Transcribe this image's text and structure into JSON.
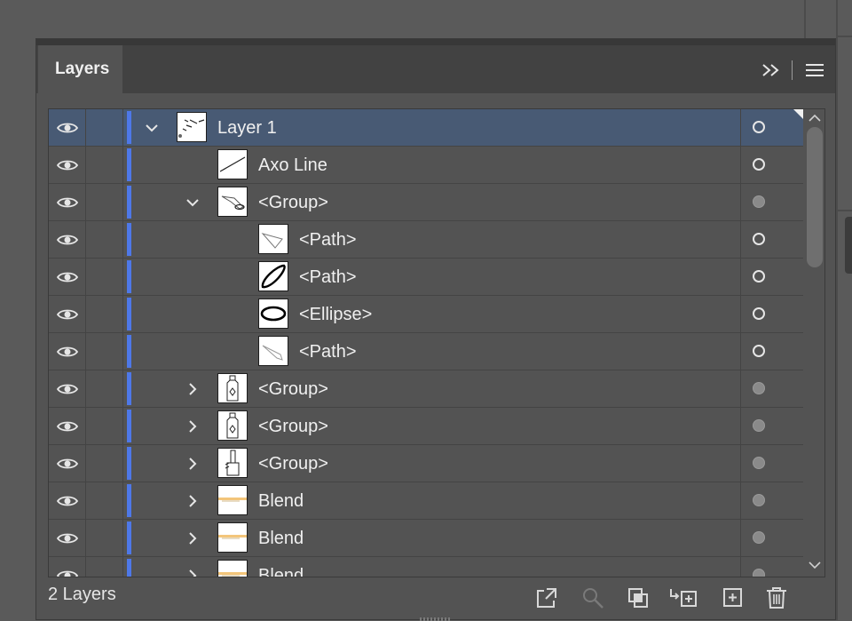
{
  "panel": {
    "tab_label": "Layers",
    "collapse_icon": "double-chevron-right-icon",
    "menu_icon": "hamburger-menu-icon"
  },
  "rows": [
    {
      "name": "Layer 1",
      "indent": 0,
      "toggle": "chevron-down",
      "thumb": "layer",
      "target": "hollow",
      "selected": true
    },
    {
      "name": "Axo Line",
      "indent": 1,
      "toggle": "none",
      "thumb": "line",
      "target": "hollow",
      "selected": false
    },
    {
      "name": "<Group>",
      "indent": 1,
      "toggle": "chevron-down",
      "thumb": "group-shape",
      "target": "filled",
      "selected": false
    },
    {
      "name": "<Path>",
      "indent": 2,
      "toggle": "none",
      "thumb": "path-light",
      "target": "hollow",
      "selected": false
    },
    {
      "name": "<Path>",
      "indent": 2,
      "toggle": "none",
      "thumb": "path-bold",
      "target": "hollow",
      "selected": false
    },
    {
      "name": "<Ellipse>",
      "indent": 2,
      "toggle": "none",
      "thumb": "ellipse",
      "target": "hollow",
      "selected": false
    },
    {
      "name": "<Path>",
      "indent": 2,
      "toggle": "none",
      "thumb": "path-faint",
      "target": "hollow",
      "selected": false
    },
    {
      "name": "<Group>",
      "indent": 1,
      "toggle": "chevron-right",
      "thumb": "bottle",
      "target": "filled",
      "selected": false
    },
    {
      "name": "<Group>",
      "indent": 1,
      "toggle": "chevron-right",
      "thumb": "bottle",
      "target": "filled",
      "selected": false
    },
    {
      "name": "<Group>",
      "indent": 1,
      "toggle": "chevron-right",
      "thumb": "brush",
      "target": "filled",
      "selected": false
    },
    {
      "name": "Blend",
      "indent": 1,
      "toggle": "chevron-right",
      "thumb": "blend",
      "target": "filled",
      "selected": false
    },
    {
      "name": "Blend",
      "indent": 1,
      "toggle": "chevron-right",
      "thumb": "blend",
      "target": "filled",
      "selected": false
    },
    {
      "name": "Blend",
      "indent": 1,
      "toggle": "chevron-right",
      "thumb": "blend",
      "target": "filled",
      "selected": false
    }
  ],
  "footer": {
    "layer_count": "2 Layers",
    "buttons": [
      {
        "name": "export-button",
        "icon": "export-icon"
      },
      {
        "name": "locate-object-button",
        "icon": "magnifier-icon"
      },
      {
        "name": "clipping-mask-button",
        "icon": "clipping-mask-icon"
      },
      {
        "name": "create-sublayer-button",
        "icon": "new-sublayer-icon"
      },
      {
        "name": "create-layer-button",
        "icon": "new-layer-icon"
      },
      {
        "name": "delete-button",
        "icon": "trash-icon"
      }
    ]
  },
  "colors": {
    "layer_color": "#4e78e8",
    "selection": "#485a74",
    "panel_bg": "#535353"
  }
}
